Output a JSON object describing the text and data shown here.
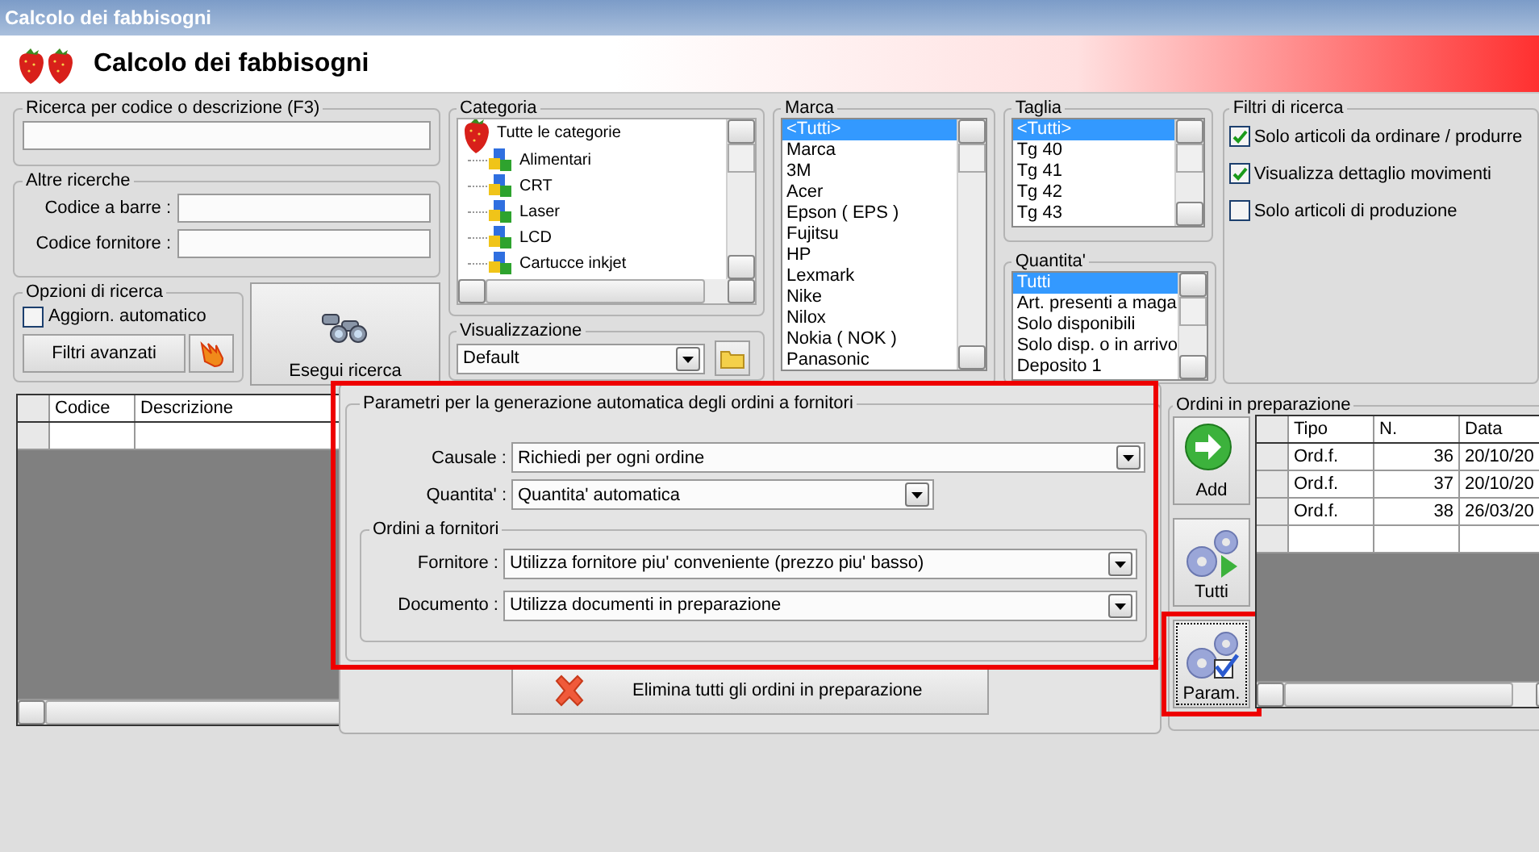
{
  "window": {
    "title": "Calcolo dei fabbisogni"
  },
  "header": {
    "title": "Calcolo dei fabbisogni"
  },
  "search": {
    "label": "Ricerca per codice o descrizione (F3)"
  },
  "other_searches": {
    "label": "Altre ricerche",
    "fields": [
      {
        "label": "Codice a barre :"
      },
      {
        "label": "Codice fornitore :"
      }
    ]
  },
  "search_options": {
    "label": "Opzioni di ricerca",
    "auto_update": {
      "label": "Aggiorn. automatico",
      "checked": false
    },
    "advanced_filters_button": "Filtri avanzati"
  },
  "run_search_button": "Esegui ricerca",
  "category": {
    "label": "Categoria",
    "root": "Tutte le categorie",
    "children": [
      {
        "label": "Alimentari"
      },
      {
        "label": "CRT"
      },
      {
        "label": "Laser"
      },
      {
        "label": "LCD"
      },
      {
        "label": "Cartucce inkjet"
      }
    ]
  },
  "view": {
    "label": "Visualizzazione",
    "value": "Default"
  },
  "brand": {
    "label": "Marca",
    "items": [
      {
        "label": "<Tutti>",
        "selected": true
      },
      {
        "label": "Marca",
        "selected": false
      },
      {
        "label": "3M",
        "selected": false
      },
      {
        "label": "Acer",
        "selected": false
      },
      {
        "label": "Epson ( EPS )",
        "selected": false
      },
      {
        "label": "Fujitsu",
        "selected": false
      },
      {
        "label": "HP",
        "selected": false
      },
      {
        "label": "Lexmark",
        "selected": false
      },
      {
        "label": "Nike",
        "selected": false
      },
      {
        "label": "Nilox",
        "selected": false
      },
      {
        "label": "Nokia ( NOK )",
        "selected": false
      },
      {
        "label": "Panasonic",
        "selected": false
      }
    ]
  },
  "size": {
    "label": "Taglia",
    "items": [
      {
        "label": "<Tutti>",
        "selected": true
      },
      {
        "label": "Tg 40",
        "selected": false
      },
      {
        "label": "Tg 41",
        "selected": false
      },
      {
        "label": "Tg 42",
        "selected": false
      },
      {
        "label": "Tg 43",
        "selected": false
      }
    ]
  },
  "quantity": {
    "label": "Quantita'",
    "items": [
      {
        "label": "Tutti",
        "selected": true
      },
      {
        "label": "Art. presenti a maga",
        "selected": false
      },
      {
        "label": "Solo disponibili",
        "selected": false
      },
      {
        "label": "Solo disp. o in arrivo",
        "selected": false
      },
      {
        "label": "Deposito 1",
        "selected": false
      }
    ]
  },
  "filters": {
    "label": "Filtri di ricerca",
    "options": [
      {
        "label": "Solo articoli da ordinare / produrre",
        "checked": true
      },
      {
        "label": "Visualizza dettaglio movimenti",
        "checked": true
      },
      {
        "label": "Solo articoli di produzione",
        "checked": false
      }
    ]
  },
  "articles_table": {
    "columns": [
      "Codice",
      "Descrizione"
    ]
  },
  "params_panel": {
    "title": "Parametri per la generazione automatica degli ordini a fornitori",
    "highlighted": true,
    "fields": [
      {
        "label": "Causale :",
        "value": "Richiedi per ogni ordine"
      },
      {
        "label": "Quantita' :",
        "value": "Quantita' automatica"
      }
    ],
    "supplier_orders": {
      "title": "Ordini a fornitori",
      "fields": [
        {
          "label": "Fornitore :",
          "value": "Utilizza fornitore piu' conveniente (prezzo piu' basso)"
        },
        {
          "label": "Documento :",
          "value": "Utilizza documenti in preparazione"
        }
      ]
    },
    "delete_button": "Elimina tutti gli ordini in preparazione"
  },
  "orders": {
    "label": "Ordini in preparazione",
    "buttons": [
      {
        "kind": "add",
        "label": "Add",
        "highlighted": false
      },
      {
        "kind": "all",
        "label": "Tutti",
        "highlighted": false
      },
      {
        "kind": "params",
        "label": "Param.",
        "highlighted": true
      }
    ],
    "table": {
      "columns": [
        "Tipo",
        "N.",
        "Data"
      ],
      "rows": [
        [
          "Ord.f.",
          "36",
          "20/10/20"
        ],
        [
          "Ord.f.",
          "37",
          "20/10/20"
        ],
        [
          "Ord.f.",
          "38",
          "26/03/20"
        ]
      ]
    }
  }
}
